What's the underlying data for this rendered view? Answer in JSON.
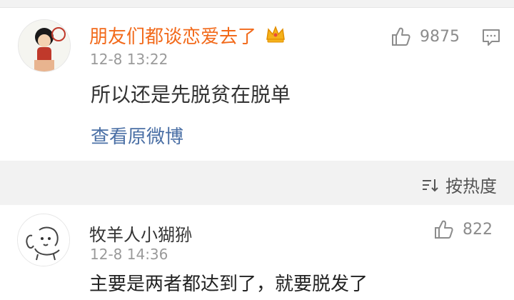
{
  "post": {
    "username": "朋友们都谈恋爱去了",
    "badge_icon": "vip-crown-icon",
    "timestamp": "12-8 13:22",
    "content": "所以还是先脱贫在脱单",
    "like_count": "9875",
    "view_original": "查看原微博"
  },
  "sort": {
    "label": "按热度"
  },
  "comments": [
    {
      "username": "牧羊人小猢狲",
      "timestamp": "12-8 14:36",
      "content": "主要是两者都达到了，就要脱发了",
      "like_count": "822"
    }
  ],
  "colors": {
    "username_orange": "#f26a1b",
    "link_blue": "#4a6fa5",
    "muted_gray": "#9a9a9a",
    "background": "#f2f2f2"
  }
}
